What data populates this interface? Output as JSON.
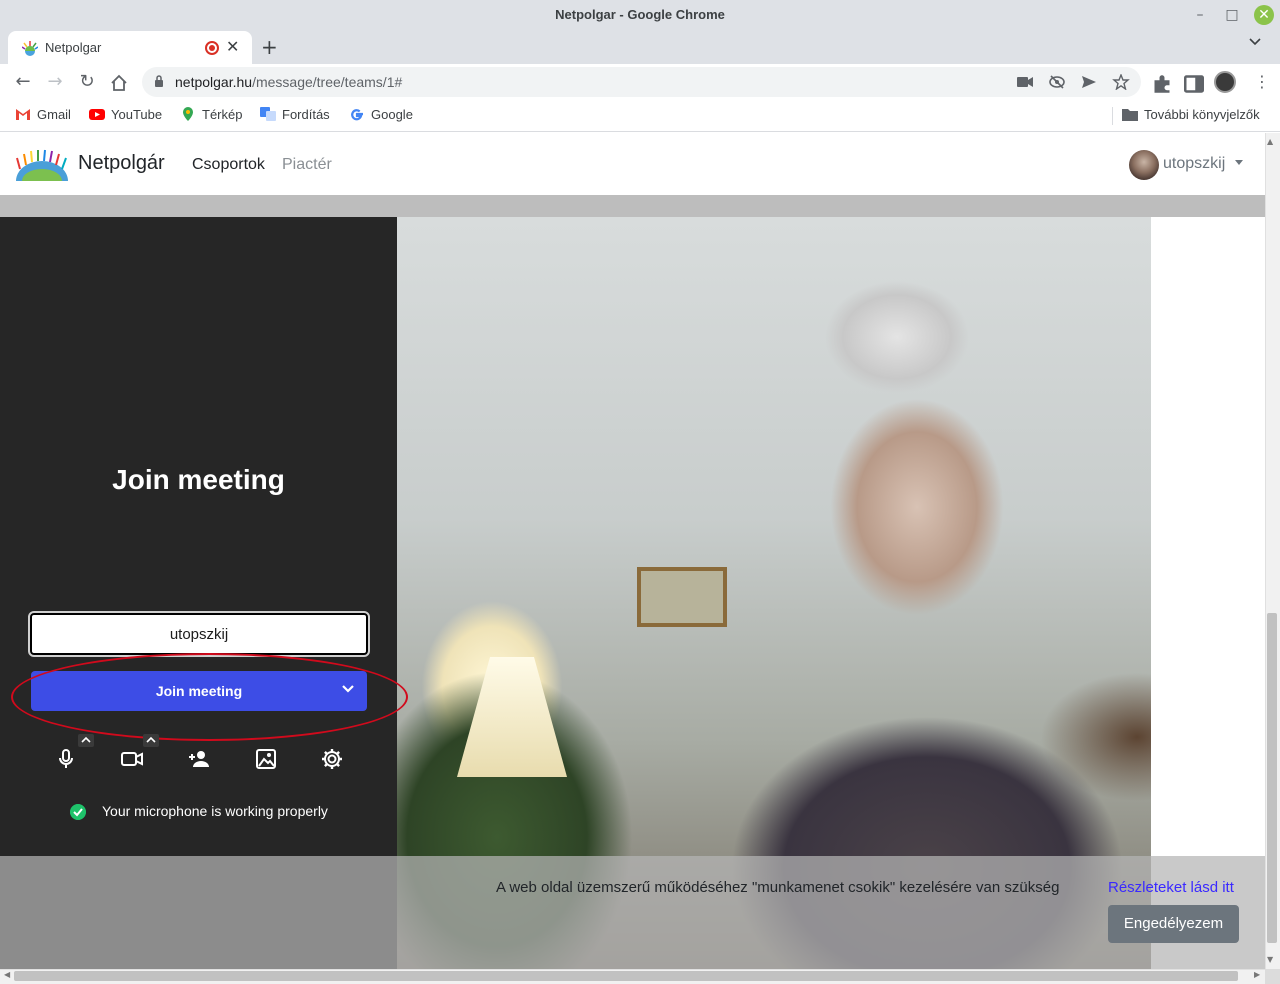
{
  "window": {
    "title": "Netpolgar - Google Chrome"
  },
  "tab": {
    "label": "Netpolgar"
  },
  "address": {
    "host": "netpolgar.hu",
    "path": "/message/tree/teams/1#"
  },
  "bookmarks": {
    "items": [
      "Gmail",
      "YouTube",
      "Térkép",
      "Fordítás",
      "Google"
    ],
    "other": "További könyvjelzők"
  },
  "site": {
    "brand": "Netpolgár",
    "nav": [
      "Csoportok",
      "Piactér"
    ],
    "user": "utopszkij"
  },
  "prejoin": {
    "title": "Join meeting",
    "name_value": "utopszkij",
    "join_label": "Join meeting",
    "mic_status": "Your microphone is working properly"
  },
  "cookie": {
    "text": "A web oldal üzemszerű működéséhez \"munkamenet csokik\" kezelésére van szükség",
    "link": "Részleteket lásd itt",
    "button": "Engedélyezem"
  },
  "colors": {
    "join_button": "#3d4de6",
    "annotation": "#d10a1c",
    "status_ok": "#1ec26a",
    "cookie_link": "#3a29ff"
  }
}
